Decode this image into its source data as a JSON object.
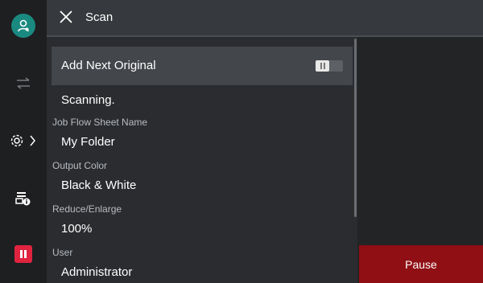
{
  "header": {
    "title": "Scan"
  },
  "panel": {
    "toggle_label": "Add Next Original",
    "toggle_state": "off",
    "status": "Scanning.",
    "fields": [
      {
        "label": "Job Flow Sheet Name",
        "value": "My Folder"
      },
      {
        "label": "Output Color",
        "value": "Black & White"
      },
      {
        "label": "Reduce/Enlarge",
        "value": "100%"
      },
      {
        "label": "User",
        "value": "Administrator"
      }
    ]
  },
  "actions": {
    "pause_label": "Pause"
  },
  "colors": {
    "avatar": "#1a8a80",
    "pause_small": "#e0243f",
    "pause_button": "#8f0f14"
  },
  "icons": [
    "user-icon",
    "swap-icon",
    "settings-icon",
    "chevron-right-icon",
    "printer-info-icon",
    "pause-icon",
    "close-icon"
  ]
}
